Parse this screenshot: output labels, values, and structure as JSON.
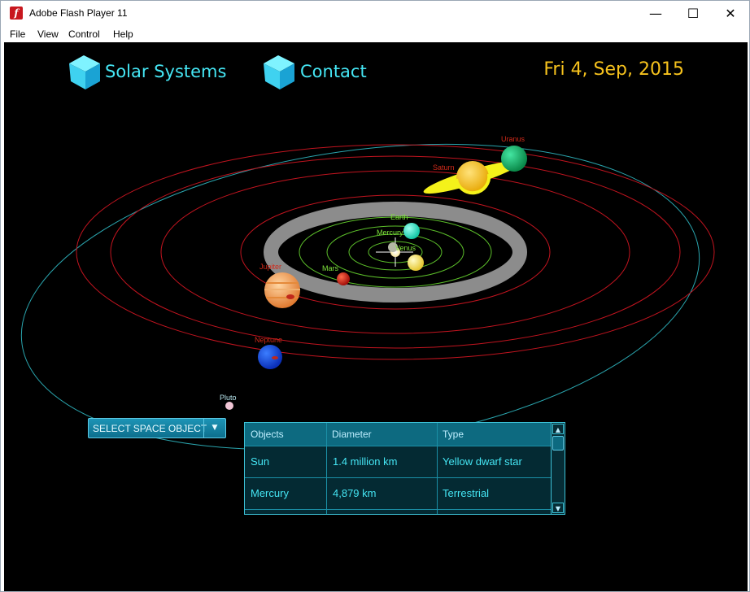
{
  "window": {
    "title": "Adobe Flash Player 11",
    "icon": "flash-player-icon",
    "buttons": [
      "minimize-icon",
      "maximize-icon",
      "close-icon"
    ]
  },
  "menu": [
    "File",
    "View",
    "Control",
    "Help"
  ],
  "nav": {
    "solar_systems": "Solar Systems",
    "contact": "Contact",
    "icon": "cube-icon"
  },
  "date": "Fri 4, Sep, 2015",
  "planets": [
    {
      "name": "Uranus",
      "color": "#d12a1a"
    },
    {
      "name": "Saturn",
      "color": "#d12a1a"
    },
    {
      "name": "Earth",
      "color": "#7fe43c"
    },
    {
      "name": "Mercury",
      "color": "#7fe43c"
    },
    {
      "name": "Venus",
      "color": "#7fe43c"
    },
    {
      "name": "Jupiter",
      "color": "#d12a1a"
    },
    {
      "name": "Mars",
      "color": "#7fe43c"
    },
    {
      "name": "Neptune",
      "color": "#d12a1a"
    },
    {
      "name": "Pluto",
      "color": "#b9e8f0"
    }
  ],
  "select": {
    "label": "SELECT SPACE OBJECT",
    "arrow": "chevron-down-icon"
  },
  "table": {
    "headers": [
      "Objects",
      "Diameter",
      "Type"
    ],
    "rows": [
      [
        "Sun",
        "1.4 million km",
        "Yellow dwarf star"
      ],
      [
        "Mercury",
        "4,879 km",
        "Terrestrial"
      ]
    ]
  },
  "colors": {
    "accent": "#45e6f4",
    "date": "#f6c21d",
    "stage_background": "#000000"
  }
}
